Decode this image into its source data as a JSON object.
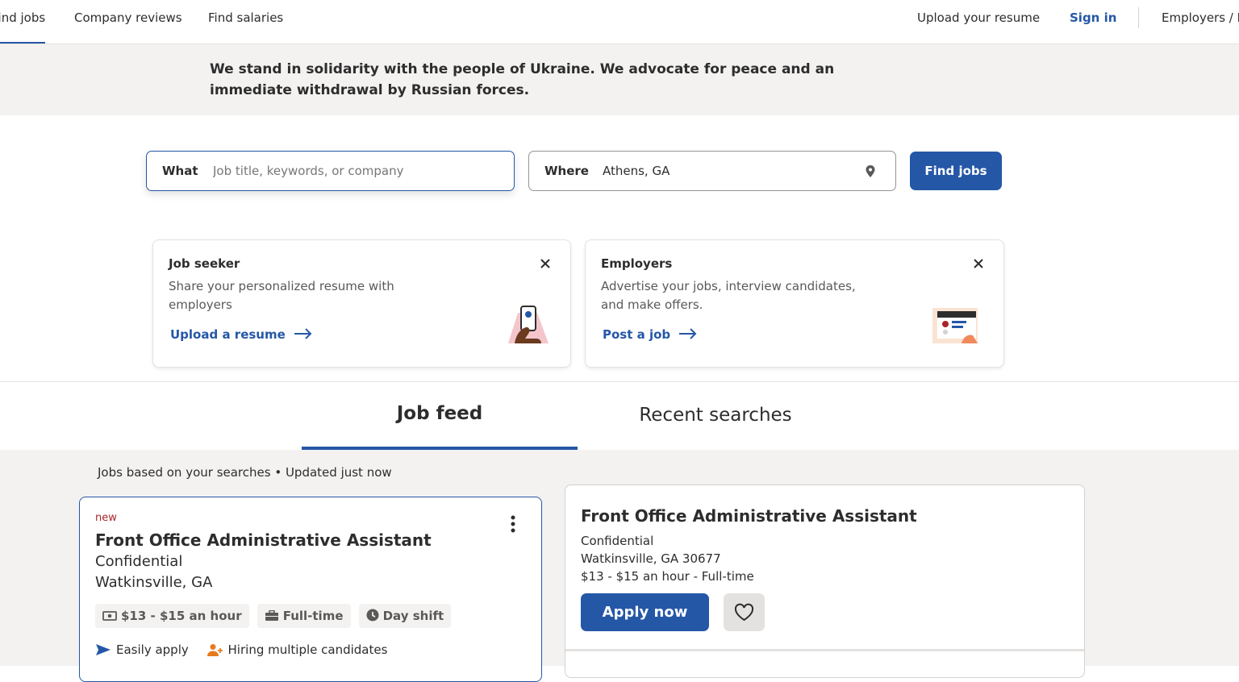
{
  "nav": {
    "left": [
      "Find jobs",
      "Company reviews",
      "Find salaries"
    ],
    "upload_resume": "Upload your resume",
    "sign_in": "Sign in",
    "employers": "Employers / Post Job"
  },
  "banner": {
    "text": "We stand in solidarity with the people of Ukraine. We advocate for peace and an immediate withdrawal by Russian forces."
  },
  "search": {
    "what_label": "What",
    "what_placeholder": "Job title, keywords, or company",
    "where_label": "Where",
    "where_value": "Athens, GA",
    "button": "Find jobs"
  },
  "promos": [
    {
      "title": "Job seeker",
      "description": "Share your personalized resume with employers",
      "link": "Upload a resume"
    },
    {
      "title": "Employers",
      "description": "Advertise your jobs, interview candidates, and make offers.",
      "link": "Post a job"
    }
  ],
  "tabs": [
    "Job feed",
    "Recent searches"
  ],
  "feed": {
    "meta": "Jobs based on your searches • Updated just now",
    "job": {
      "tag": "new",
      "title": "Front Office Administrative Assistant",
      "company": "Confidential",
      "location": "Watkinsville, GA",
      "chips": [
        "$13 - $15 an hour",
        "Full-time",
        "Day shift"
      ],
      "features": [
        "Easily apply",
        "Hiring multiple candidates"
      ]
    }
  },
  "detail": {
    "title": "Front Office Administrative Assistant",
    "company": "Confidential",
    "location": "Watkinsville, GA 30677",
    "pay": "$13 - $15 an hour  - Full-time",
    "apply": "Apply now"
  },
  "colors": {
    "brand": "#2557a7",
    "new_tag": "#a9252b",
    "feature_icon": "#e87a1e",
    "bg_gray": "#f3f2f1"
  }
}
